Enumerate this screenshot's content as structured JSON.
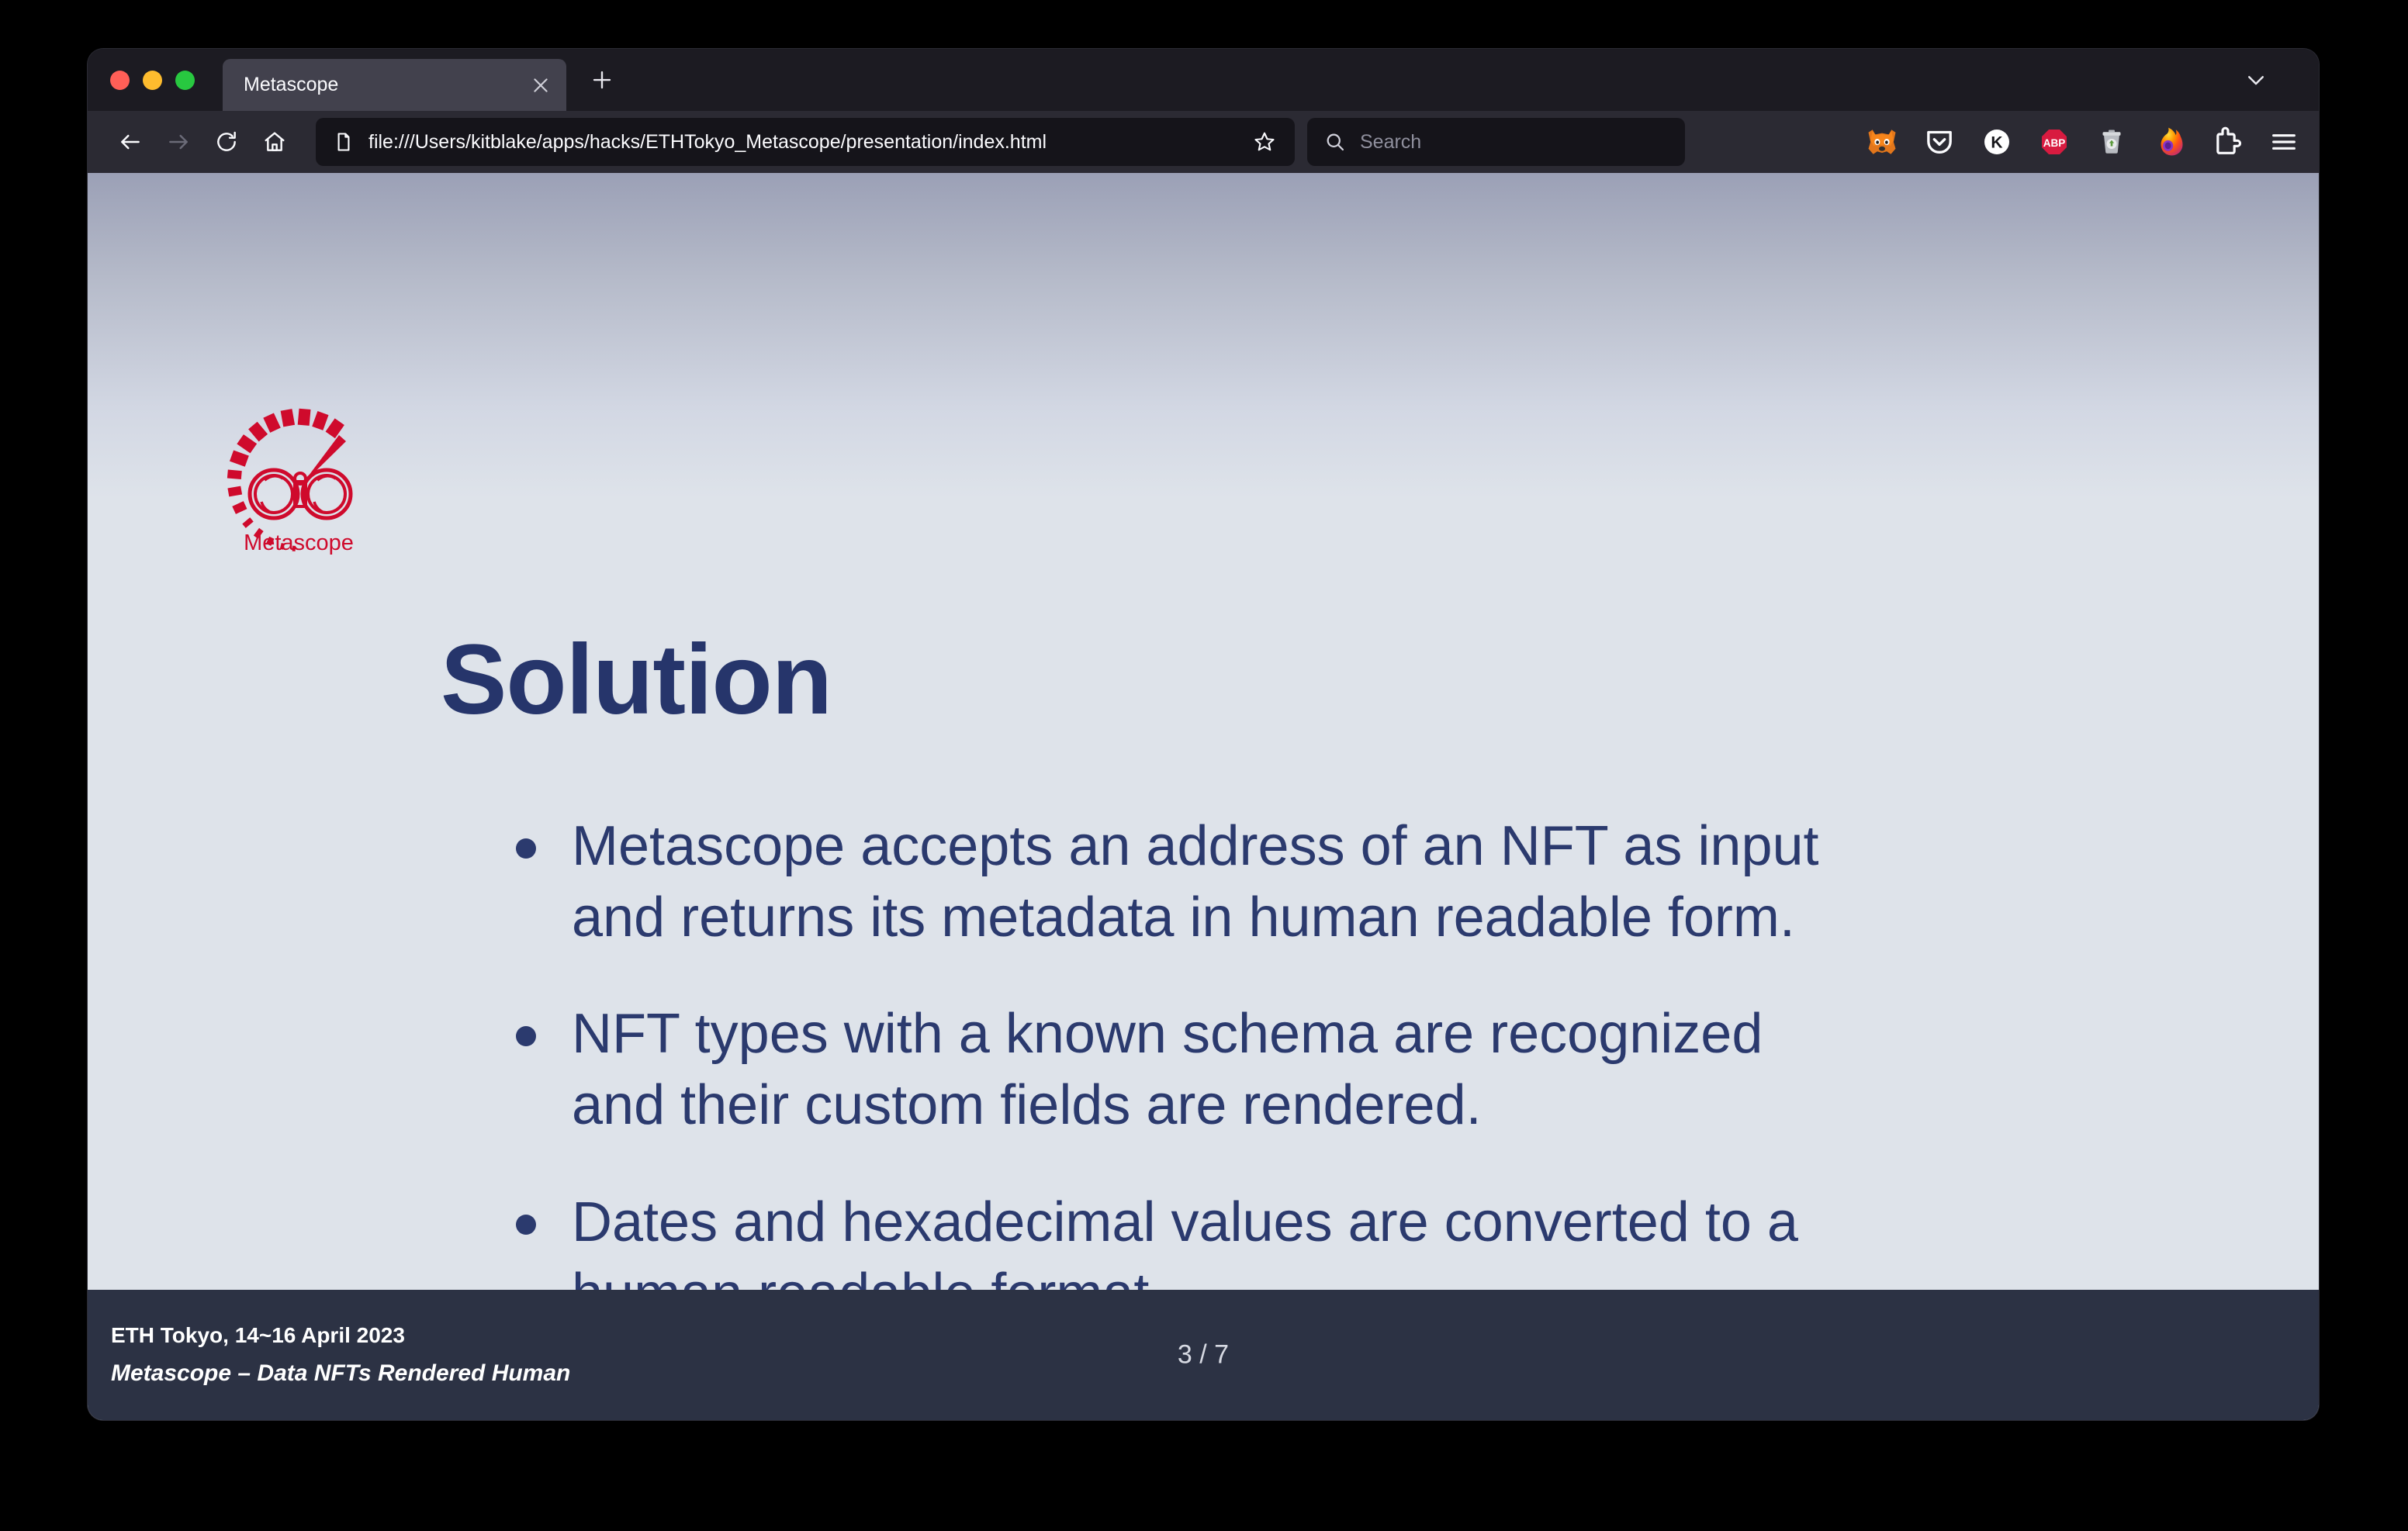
{
  "browser": {
    "tab": {
      "title": "Metascope",
      "close_icon": "close-icon"
    },
    "new_tab_icon": "plus-icon",
    "tab_list_icon": "chevron-down-icon",
    "nav": {
      "back_icon": "arrow-left-icon",
      "forward_icon": "arrow-right-icon",
      "reload_icon": "reload-icon",
      "home_icon": "home-icon"
    },
    "urlbar": {
      "page_icon": "document-icon",
      "url": "file:///Users/kitblake/apps/hacks/ETHTokyo_Metascope/presentation/index.html",
      "bookmark_icon": "star-icon"
    },
    "searchbar": {
      "search_icon": "search-icon",
      "placeholder": "Search"
    },
    "extensions": [
      {
        "name": "metamask-extension-icon",
        "label": "MetaMask"
      },
      {
        "name": "pocket-extension-icon",
        "label": "Pocket"
      },
      {
        "name": "keplr-extension-icon",
        "label": "K"
      },
      {
        "name": "adblock-plus-extension-icon",
        "label": "ABP"
      },
      {
        "name": "trash-extension-icon",
        "label": "Trash"
      },
      {
        "name": "firefox-account-icon",
        "label": "Firefox"
      },
      {
        "name": "extensions-puzzle-icon",
        "label": "Extensions"
      },
      {
        "name": "application-menu-icon",
        "label": "Menu"
      }
    ]
  },
  "slide": {
    "logo": {
      "name": "metascope-logo",
      "wordmark": "Metascope",
      "color": "#cf0a2c"
    },
    "title": "Solution",
    "bullets": [
      "Metascope accepts an address of an NFT as input and returns its metadata in human readable form.",
      "NFT types with a known schema are recognized and their custom fields are rendered.",
      "Dates and hexadecimal values are converted to a human readable format."
    ],
    "footer": {
      "event": "ETH Tokyo, 14~16 April 2023",
      "subtitle": "Metascope – Data NFTs Rendered Human",
      "page_number": "3 / 7"
    },
    "colors": {
      "title": "#26356b",
      "body": "#2b3a6e",
      "background": "#dee3ea",
      "footer_bar": "#2c3244"
    }
  }
}
